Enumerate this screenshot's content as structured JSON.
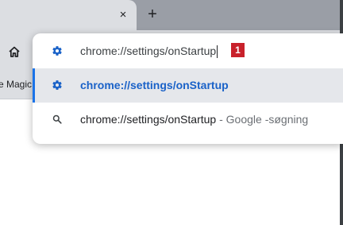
{
  "browser": {
    "new_tab_glyph": "+",
    "close_tab_glyph": "×",
    "bookmark_fragment": "e Magic"
  },
  "omnibox": {
    "value": "chrome://settings/onStartup",
    "icon": "gear-icon",
    "step_marker": "1"
  },
  "suggestions": [
    {
      "icon": "gear-icon",
      "text": "chrome://settings/onStartup",
      "selected": true
    },
    {
      "icon": "search-icon",
      "text": "chrome://settings/onStartup",
      "separator": " - ",
      "suffix": "Google -søgning",
      "selected": false
    }
  ],
  "colors": {
    "accent": "#1a73e8",
    "marker": "#c8212b",
    "chrome_bg": "#dcdee2"
  }
}
